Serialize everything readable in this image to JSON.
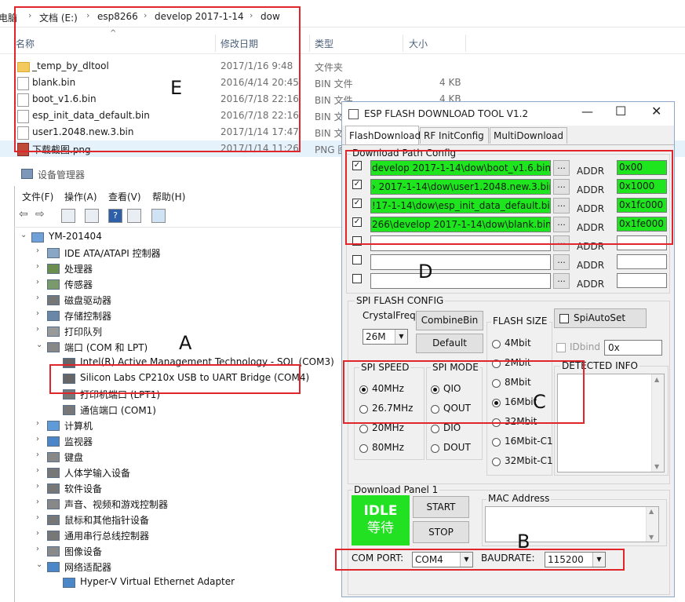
{
  "explorer": {
    "breadcrumb": [
      "电脑",
      "文档 (E:)",
      "esp8266",
      "develop 2017-1-14",
      "dow"
    ],
    "columns": {
      "name": "名称",
      "date": "修改日期",
      "type": "类型",
      "size": "大小"
    },
    "files": [
      {
        "name": "_temp_by_dltool",
        "date": "2017/1/16 9:48",
        "type": "文件夹",
        "size": "",
        "icon": "folder-icon"
      },
      {
        "name": "blank.bin",
        "date": "2016/4/14 20:45",
        "type": "BIN 文件",
        "size": "4 KB",
        "icon": "file-icon"
      },
      {
        "name": "boot_v1.6.bin",
        "date": "2016/7/18 22:16",
        "type": "BIN 文件",
        "size": "4 KB",
        "icon": "file-icon"
      },
      {
        "name": "esp_init_data_default.bin",
        "date": "2016/7/18 22:16",
        "type": "BIN 文",
        "size": "",
        "icon": "file-icon"
      },
      {
        "name": "user1.2048.new.3.bin",
        "date": "2017/1/14 17:47",
        "type": "BIN 文",
        "size": "",
        "icon": "file-icon"
      },
      {
        "name": "下载截图.png",
        "date": "2017/1/14 11:26",
        "type": "PNG 图",
        "size": "",
        "icon": "image-icon"
      }
    ]
  },
  "devmgr": {
    "title": "设备管理器",
    "menu": [
      "文件(F)",
      "操作(A)",
      "查看(V)",
      "帮助(H)"
    ],
    "root": "YM-201404",
    "tree": [
      {
        "label": "IDE ATA/ATAPI 控制器",
        "level": 1,
        "arrow": "›"
      },
      {
        "label": "处理器",
        "level": 1,
        "arrow": "›"
      },
      {
        "label": "传感器",
        "level": 1,
        "arrow": "›"
      },
      {
        "label": "磁盘驱动器",
        "level": 1,
        "arrow": "›"
      },
      {
        "label": "存储控制器",
        "level": 1,
        "arrow": "›"
      },
      {
        "label": "打印队列",
        "level": 1,
        "arrow": "›"
      },
      {
        "label": "端口 (COM 和 LPT)",
        "level": 1,
        "arrow": "⌄"
      },
      {
        "label": "Intel(R) Active Management Technology - SOL (COM3)",
        "level": 2,
        "arrow": ""
      },
      {
        "label": "Silicon Labs CP210x USB to UART Bridge (COM4)",
        "level": 2,
        "arrow": ""
      },
      {
        "label": "打印机端口 (LPT1)",
        "level": 2,
        "arrow": ""
      },
      {
        "label": "通信端口 (COM1)",
        "level": 2,
        "arrow": ""
      },
      {
        "label": "计算机",
        "level": 1,
        "arrow": "›"
      },
      {
        "label": "监视器",
        "level": 1,
        "arrow": "›"
      },
      {
        "label": "键盘",
        "level": 1,
        "arrow": "›"
      },
      {
        "label": "人体学输入设备",
        "level": 1,
        "arrow": "›"
      },
      {
        "label": "软件设备",
        "level": 1,
        "arrow": "›"
      },
      {
        "label": "声音、视频和游戏控制器",
        "level": 1,
        "arrow": "›"
      },
      {
        "label": "鼠标和其他指针设备",
        "level": 1,
        "arrow": "›"
      },
      {
        "label": "通用串行总线控制器",
        "level": 1,
        "arrow": "›"
      },
      {
        "label": "图像设备",
        "level": 1,
        "arrow": "›"
      },
      {
        "label": "网络适配器",
        "level": 1,
        "arrow": "⌄"
      },
      {
        "label": "Hyper-V Virtual Ethernet Adapter",
        "level": 2,
        "arrow": ""
      }
    ]
  },
  "esp": {
    "title": "ESP FLASH DOWNLOAD TOOL V1.2",
    "tabs": [
      "FlashDownload",
      "RF InitConfig",
      "MultiDownload"
    ],
    "path_group": "Download Path Config",
    "addr_label": "ADDR",
    "dots": "...",
    "paths": [
      {
        "checked": true,
        "path": "develop 2017-1-14\\dow\\boot_v1.6.bin",
        "addr": "0x00"
      },
      {
        "checked": true,
        "path": "› 2017-1-14\\dow\\user1.2048.new.3.bin",
        "addr": "0x1000"
      },
      {
        "checked": true,
        "path": "!17-1-14\\dow\\esp_init_data_default.bin",
        "addr": "0x1fc000"
      },
      {
        "checked": true,
        "path": "266\\develop 2017-1-14\\dow\\blank.bin",
        "addr": "0x1fe000"
      },
      {
        "checked": false,
        "path": "",
        "addr": ""
      },
      {
        "checked": false,
        "path": "",
        "addr": ""
      },
      {
        "checked": false,
        "path": "",
        "addr": ""
      }
    ],
    "spi": {
      "group": "SPI FLASH CONFIG",
      "crystal_label": "CrystalFreq",
      "crystal_value": "26M",
      "combine": "CombineBin",
      "default": "Default",
      "flash_size_label": "FLASH SIZE",
      "flash_sizes": [
        "4Mbit",
        "2Mbit",
        "8Mbit",
        "16Mbit",
        "32Mbit",
        "16Mbit-C1",
        "32Mbit-C1"
      ],
      "flash_size_selected": 3,
      "speed_label": "SPI SPEED",
      "speeds": [
        "40MHz",
        "26.7MHz",
        "20MHz",
        "80MHz"
      ],
      "speed_selected": 0,
      "mode_label": "SPI MODE",
      "modes": [
        "QIO",
        "QOUT",
        "DIO",
        "DOUT"
      ],
      "mode_selected": 0,
      "autoset": "SpiAutoSet",
      "idbind": "IDbind",
      "idbind_value": "0x",
      "detected": "DETECTED INFO"
    },
    "panel": {
      "group": "Download Panel 1",
      "state": "IDLE",
      "state_cn": "等待",
      "state_color": "#22e022",
      "start": "START",
      "stop": "STOP",
      "mac": "MAC Address",
      "com_label": "COM PORT:",
      "com_value": "COM4",
      "baud_label": "BAUDRATE:",
      "baud_value": "115200"
    }
  },
  "annotations": {
    "a": "A",
    "b": "B",
    "c": "C",
    "d": "D",
    "e": "E"
  },
  "colors": {
    "highlight": "#e0252b",
    "path_on": "#1ee51e"
  }
}
